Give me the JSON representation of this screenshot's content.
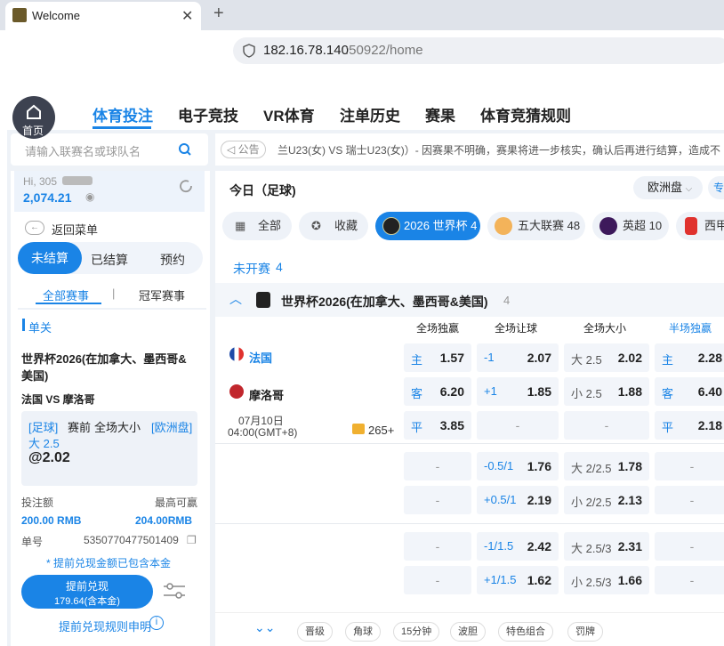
{
  "browser": {
    "tab_title": "Welcome",
    "url_host": "182.16.78.140",
    "url_rest": ":50922/home"
  },
  "nav": {
    "home": "首页",
    "items": [
      "体育投注",
      "电子竞技",
      "VR体育",
      "注单历史",
      "赛果",
      "体育竞猜规则"
    ]
  },
  "search": {
    "placeholder": "请输入联赛名或球队名"
  },
  "notice": {
    "label": "公告",
    "text": "兰U23(女) VS 瑞士U23(女)）- 因赛果不明确，赛果将进一步核实，确认后再进行结算，造成不"
  },
  "account": {
    "greeting": "Hi, 305",
    "balance": "2,074.21",
    "back": "返回菜单"
  },
  "bet_tabs": [
    "未结算",
    "已结算",
    "预约"
  ],
  "sub_tabs": [
    "全部赛事",
    "冠军赛事"
  ],
  "slip": {
    "type": "单关",
    "league": "世界杯2026(在加拿大、墨西哥&美国)",
    "match": "法国 VS 摩洛哥",
    "sport": "[足球]",
    "phase": "赛前",
    "market": "全场大小",
    "odds_type": "[欧洲盘]",
    "selection": "大 2.5",
    "price": "@2.02",
    "stake_label": "投注额",
    "maxwin_label": "最高可赢",
    "stake": "200.00 RMB",
    "maxwin": "204.00RMB",
    "id_label": "单号",
    "id": "5350770477501409",
    "note": "* 提前兑现金额已包含本金",
    "cashout_label": "提前兑现",
    "cashout_value": "179.64(含本金)",
    "rules_link": "提前兑现规则申明"
  },
  "main": {
    "today": "今日（足球)",
    "odds_format": "欧洲盘",
    "special": "专",
    "upcoming": "未开赛",
    "upcoming_count": "4",
    "filters": [
      {
        "label": "全部"
      },
      {
        "label": "收藏"
      },
      {
        "label": "2026 世界杯 4"
      },
      {
        "label": "五大联赛 48"
      },
      {
        "label": "英超 10"
      },
      {
        "label": "西甲"
      }
    ],
    "league": "世界杯2026(在加拿大、墨西哥&美国)",
    "league_count": "4",
    "headers": [
      "全场独赢",
      "全场让球",
      "全场大小",
      "半场独赢"
    ],
    "home": "法国",
    "away": "摩洛哥",
    "date": "07月10日",
    "time": "04:00(GMT+8)",
    "more": "265+",
    "rows": [
      {
        "s": "主",
        "w": "1.57",
        "h": "-1",
        "ho": "2.07",
        "t": "大 2.5",
        "to": "2.02",
        "hs": "主",
        "hw": "2.28"
      },
      {
        "s": "客",
        "w": "6.20",
        "h": "+1",
        "ho": "1.85",
        "t": "小 2.5",
        "to": "1.88",
        "hs": "客",
        "hw": "6.40"
      },
      {
        "s": "平",
        "w": "3.85",
        "h": "-",
        "ho": "",
        "t": "-",
        "to": "",
        "hs": "平",
        "hw": "2.18"
      },
      {
        "s": "",
        "w": "-",
        "h": "-0.5/1",
        "ho": "1.76",
        "t": "大 2/2.5",
        "to": "1.78",
        "hs": "",
        "hw": "-"
      },
      {
        "s": "",
        "w": "-",
        "h": "+0.5/1",
        "ho": "2.19",
        "t": "小 2/2.5",
        "to": "2.13",
        "hs": "",
        "hw": "-"
      },
      {
        "s": "",
        "w": "-",
        "h": "-1/1.5",
        "ho": "2.42",
        "t": "大 2.5/3",
        "to": "2.31",
        "hs": "",
        "hw": "-"
      },
      {
        "s": "",
        "w": "-",
        "h": "+1/1.5",
        "ho": "1.62",
        "t": "小 2.5/3",
        "to": "1.66",
        "hs": "",
        "hw": "-"
      }
    ],
    "bottom_chips": [
      "晋级",
      "角球",
      "15分钟",
      "波胆",
      "特色组合",
      "罚牌"
    ]
  }
}
